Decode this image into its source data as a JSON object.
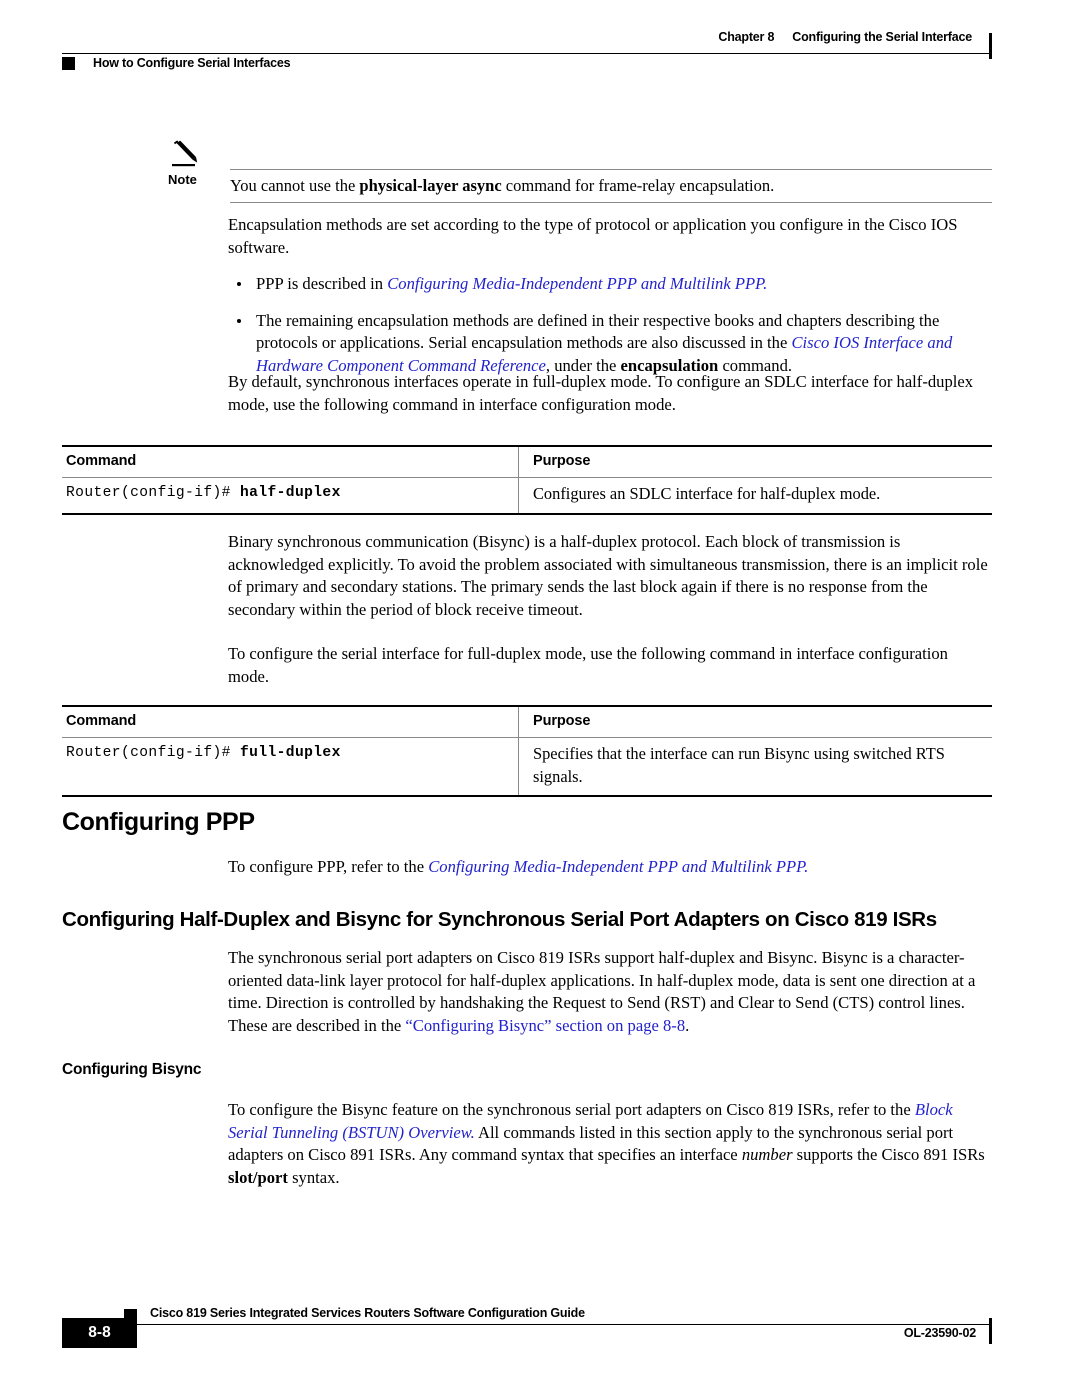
{
  "header": {
    "chapter_label": "Chapter 8",
    "chapter_title": "Configuring the Serial Interface",
    "section_title": "How to Configure Serial Interfaces"
  },
  "note": {
    "label": "Note",
    "text_before": "You cannot use the ",
    "bold_command": "physical-layer async",
    "text_after": " command for frame-relay encapsulation."
  },
  "content": {
    "para_encapsulation": "Encapsulation methods are set according to the type of protocol or application you configure in the Cisco IOS software.",
    "bullet1_text": "PPP is described in ",
    "bullet1_link": "Configuring Media-Independent PPP and Multilink PPP.",
    "bullet2_part1": "The remaining encapsulation methods are defined in their respective books and chapters describing the protocols or applications. Serial encapsulation methods are also discussed in the ",
    "bullet2_link": "Cisco IOS Interface and Hardware Component Command Reference",
    "bullet2_part2": ", under the ",
    "bullet2_bold": "encapsulation",
    "bullet2_part3": " command.",
    "para_fullduplex_default": "By default, synchronous interfaces operate in full-duplex mode. To configure an SDLC interface for half-duplex mode, use the following command in interface configuration mode.",
    "para_bisync": "Binary synchronous communication (Bisync) is a half-duplex protocol. Each block of transmission is acknowledged explicitly. To avoid the problem associated with simultaneous transmission, there is an implicit role of primary and secondary stations. The primary sends the last block again if there is no response from the secondary within the period of block receive timeout.",
    "para_configure_full": "To configure the serial interface for full-duplex mode, use the following command in interface configuration mode."
  },
  "table_half_duplex": {
    "header_command": "Command",
    "header_purpose": "Purpose",
    "row_prompt": "Router(config-if)# ",
    "row_command": "half-duplex",
    "row_purpose": "Configures an SDLC interface for half-duplex mode."
  },
  "table_full_duplex": {
    "header_command": "Command",
    "header_purpose": "Purpose",
    "row_prompt": "Router(config-if)# ",
    "row_command": "full-duplex",
    "row_purpose": "Specifies that the interface can run Bisync using switched RTS signals."
  },
  "section_ppp": {
    "heading": "Configuring PPP",
    "para_prefix": "To configure PPP, refer to the ",
    "para_link": "Configuring Media-Independent PPP and Multilink PPP."
  },
  "section_halfduplex_bisync": {
    "heading": "Configuring Half-Duplex and Bisync for Synchronous Serial Port Adapters on Cisco 819 ISRs",
    "para_part1": "The synchronous serial port adapters on Cisco 819 ISRs support half-duplex and Bisync. Bisync is a character-oriented data-link layer protocol for half-duplex applications. In half-duplex mode, data is sent one direction at a time. Direction is controlled by handshaking the Request to Send (RST) and Clear to Send (CTS) control lines. These are described in the ",
    "para_link": "“Configuring Bisync” section on page 8-8",
    "para_part2": "."
  },
  "section_bisync": {
    "heading": "Configuring Bisync",
    "para_part1": "To configure the Bisync feature on the synchronous serial port adapters on Cisco 819 ISRs, refer to the ",
    "para_link": "Block Serial Tunneling (BSTUN) Overview.",
    "para_part2": " All commands listed in this section apply to the synchronous serial port adapters on Cisco 891 ISRs. Any command syntax that specifies an interface ",
    "para_italic": "number",
    "para_part3": " supports the Cisco 891 ISRs ",
    "para_bold": "slot/port",
    "para_part4": " syntax."
  },
  "footer": {
    "page_number": "8-8",
    "guide_title": "Cisco 819 Series Integrated Services Routers Software Configuration Guide",
    "doc_number": "OL-23590-02"
  },
  "colors": {
    "link": "#2222cc",
    "rule_light": "#8a8a8a",
    "rule_dark": "#000000"
  }
}
